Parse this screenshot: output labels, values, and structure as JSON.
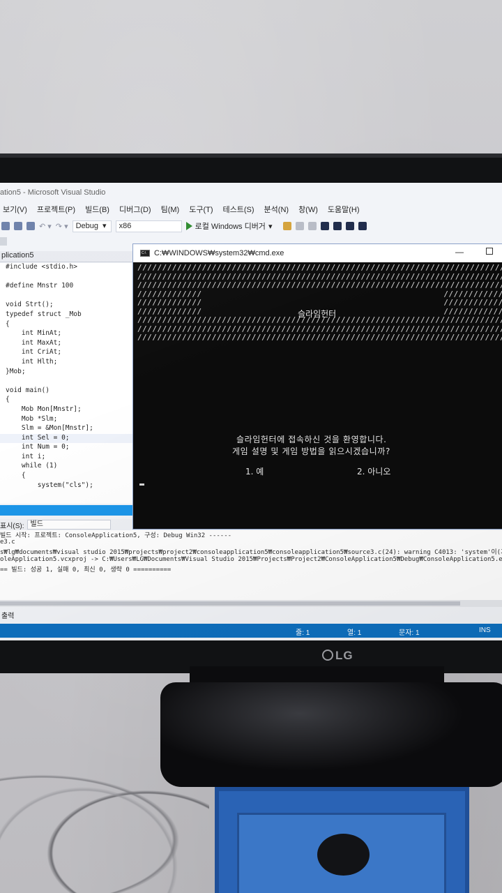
{
  "vs": {
    "title": "ation5 - Microsoft Visual Studio",
    "menu": [
      "보기(V)",
      "프로젝트(P)",
      "빌드(B)",
      "디버그(D)",
      "팀(M)",
      "도구(T)",
      "테스트(S)",
      "분석(N)",
      "창(W)",
      "도움말(H)"
    ],
    "toolbar": {
      "config": "Debug",
      "platform": "x86",
      "run_label": "로컬 Windows 디버거"
    },
    "doc_tab": "plication5",
    "code_lines": [
      "#include <stdio.h>",
      "",
      "#define Mnstr 100",
      "",
      "void Strt();",
      "typedef struct _Mob",
      "{",
      "    int MinAt;",
      "    int MaxAt;",
      "    int CriAt;",
      "    int Hlth;",
      "}Mob;",
      "",
      "void main()",
      "{",
      "    Mob Mon[Mnstr];",
      "    Mob *Slm;",
      "    Slm = &Mon[Mnstr];",
      "    int Sel = 0;",
      "    int Num = 0;",
      "    int i;",
      "    while (1)",
      "    {",
      "        system(\"cls\");"
    ],
    "output_source_label": "표시(S):",
    "output_source_value": "빌드",
    "output_lines": [
      "빌드 시작: 프로젝트: ConsoleApplication5, 구성: Debug Win32 ------",
      "e3.c",
      "s₩lg₩documents₩visual studio 2015₩projects₩project2₩consoleapplication5₩consoleapplication5₩source3.c(24): warning C4013: 'system'이(가) 정의되지",
      "oleApplication5.vcxproj -> C:₩Users₩LG₩Documents₩Visual Studio 2015₩Projects₩Project2₩ConsoleApplication5₩Debug₩ConsoleApplication5.exe",
      "== 빌드: 성공 1, 실패 0, 최신 0, 생략 0 =========="
    ],
    "output_tab": "출력",
    "status": {
      "line": "줄: 1",
      "col": "열: 1",
      "char": "문자: 1",
      "mode": "INS"
    }
  },
  "cmd": {
    "title": "C:₩WINDOWS₩system32₩cmd.exe",
    "heading": "슬라임헌터",
    "welcome": "슬라임헌터에 접속하신 것을 환영합니다.",
    "question": "게임 설명 및 게임 방법을 읽으시겠습니까?",
    "option1": "1. 예",
    "option2": "2. 아니오"
  },
  "monitor": {
    "brand": "LG"
  }
}
